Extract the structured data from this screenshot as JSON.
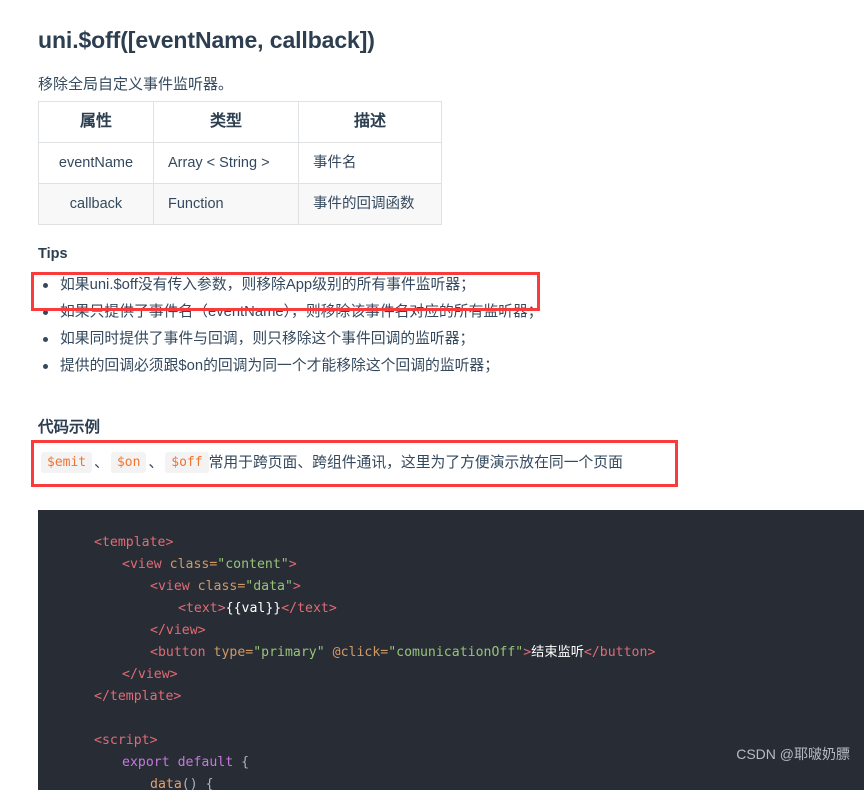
{
  "doc": {
    "title": "uni.$off([eventName, callback])",
    "description": "移除全局自定义事件监听器。"
  },
  "table": {
    "headers": [
      "属性",
      "类型",
      "描述"
    ],
    "rows": [
      [
        "eventName",
        "Array < String >",
        "事件名"
      ],
      [
        "callback",
        "Function",
        "事件的回调函数"
      ]
    ]
  },
  "tips": {
    "heading": "Tips",
    "items": [
      "如果uni.$off没有传入参数，则移除App级别的所有事件监听器；",
      "如果只提供了事件名（eventName），则移除该事件名对应的所有监听器；",
      "如果同时提供了事件与回调，则只移除这个事件回调的监听器；",
      "提供的回调必须跟$on的回调为同一个才能移除这个回调的监听器；"
    ]
  },
  "code_example": {
    "heading": "代码示例",
    "note": {
      "code_1": "$emit",
      "sep_1": "、",
      "code_2": "$on",
      "sep_2": "、",
      "code_3": "$off",
      "text": "常用于跨页面、跨组件通讯，这里为了方便演示放在同一个页面"
    },
    "lines": {
      "l1_tag_open": "<template>",
      "l2_tag": "<view ",
      "l2_attr": "class=",
      "l2_str": "\"content\"",
      "l2_close": ">",
      "l3_tag": "<view ",
      "l3_attr": "class=",
      "l3_str": "\"data\"",
      "l3_close": ">",
      "l4_tag_open": "<text>",
      "l4_text": "{{val}}",
      "l4_tag_close": "</text>",
      "l5_tag_close": "</view>",
      "l6_tag": "<button ",
      "l6_attr1": "type=",
      "l6_str1": "\"primary\"",
      "l6_attr2": " @click=",
      "l6_str2": "\"comunicationOff\"",
      "l6_gt": ">",
      "l6_text": "结束监听",
      "l6_tag_close": "</button>",
      "l7_tag_close": "</view>",
      "l8_tag_close": "</template>",
      "l10_tag_open": "<script>",
      "l11_kw1": "export",
      "l11_kw2": " default",
      "l11_brace": " {",
      "l12_fn": "data",
      "l12_rest": "() {"
    }
  },
  "watermark": "CSDN @耶啵奶膘",
  "colors": {
    "annotation": "#f93b3b",
    "code_bg": "#272c35",
    "inline_code_text": "#f37430",
    "text": "#34495e"
  }
}
